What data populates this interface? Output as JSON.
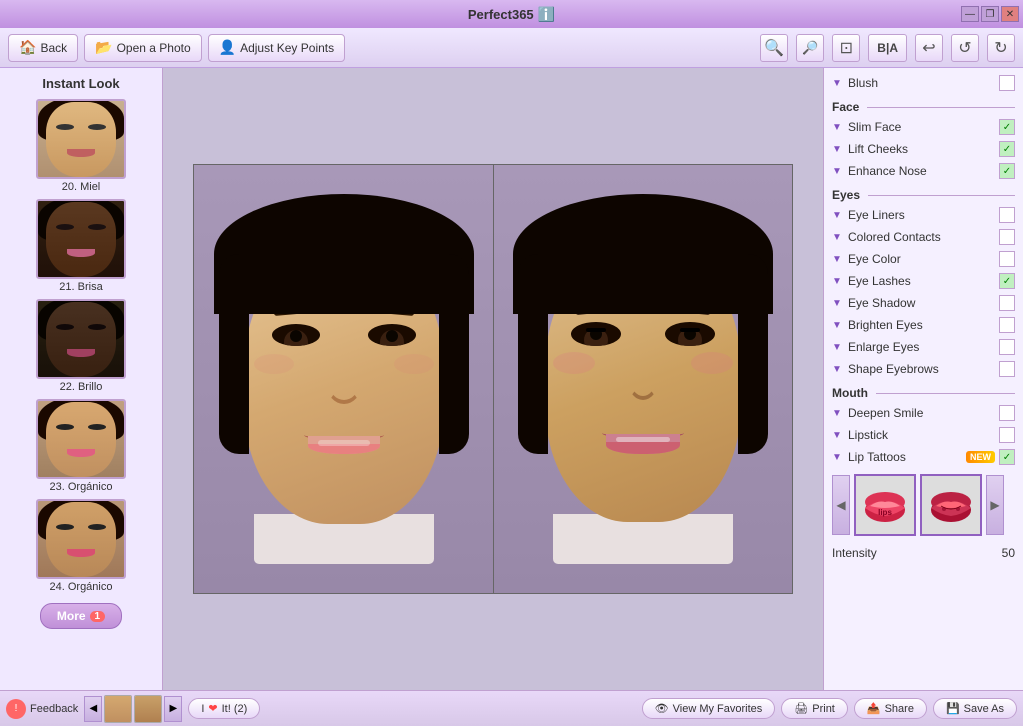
{
  "app": {
    "title": "Perfect365",
    "info_icon": "ℹ️"
  },
  "win_controls": {
    "minimize": "—",
    "restore": "❐",
    "close": "✕"
  },
  "toolbar": {
    "back_label": "Back",
    "open_photo_label": "Open a Photo",
    "adjust_key_points_label": "Adjust Key Points",
    "zoom_in": "🔍",
    "zoom_out": "🔍",
    "fit": "⊡",
    "bia": "B|A",
    "undo": "↩",
    "undo2": "↺",
    "redo": "↻"
  },
  "sidebar": {
    "title": "Instant Look",
    "items": [
      {
        "id": 20,
        "label": "20. Miel",
        "skin": "medium"
      },
      {
        "id": 21,
        "label": "21. Brisa",
        "skin": "dark"
      },
      {
        "id": 22,
        "label": "22. Brillo",
        "skin": "dark"
      },
      {
        "id": 23,
        "label": "23. Orgánico",
        "skin": "medium"
      },
      {
        "id": 24,
        "label": "24. Orgánico",
        "skin": "medium"
      }
    ],
    "more_label": "More",
    "more_count": "1"
  },
  "right_panel": {
    "blush_label": "Blush",
    "face_section": "Face",
    "face_items": [
      {
        "label": "Slim Face",
        "checked": true
      },
      {
        "label": "Lift Cheeks",
        "checked": true
      },
      {
        "label": "Enhance Nose",
        "checked": true
      }
    ],
    "eyes_section": "Eyes",
    "eyes_items": [
      {
        "label": "Eye Liners",
        "checked": false
      },
      {
        "label": "Colored Contacts",
        "checked": false
      },
      {
        "label": "Eye Color",
        "checked": false
      },
      {
        "label": "Eye Lashes",
        "checked": true
      },
      {
        "label": "Eye Shadow",
        "checked": false
      },
      {
        "label": "Brighten Eyes",
        "checked": false
      },
      {
        "label": "Enlarge Eyes",
        "checked": false
      },
      {
        "label": "Shape Eyebrows",
        "checked": false
      }
    ],
    "mouth_section": "Mouth",
    "mouth_items": [
      {
        "label": "Deepen Smile",
        "checked": false
      },
      {
        "label": "Lipstick",
        "checked": false
      },
      {
        "label": "Lip Tattoos",
        "checked": true,
        "new": true
      }
    ],
    "intensity_label": "Intensity",
    "intensity_value": "50"
  },
  "bottom_bar": {
    "feedback_label": "Feedback",
    "i_love_it_label": "I",
    "i_love_it_suffix": "It! (2)",
    "view_favorites_label": "View My Favorites",
    "print_label": "Print",
    "share_label": "Share",
    "save_as_label": "Save As"
  }
}
